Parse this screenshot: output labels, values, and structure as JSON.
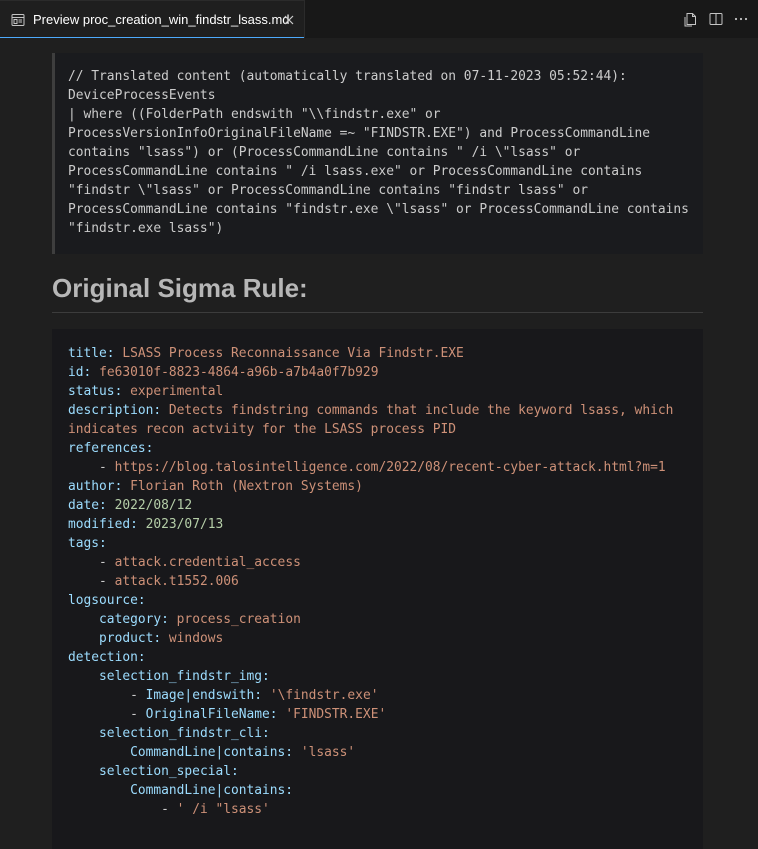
{
  "tab": {
    "label": "Preview proc_creation_win_findstr_lsass.md",
    "icon": "preview-icon",
    "close_icon": "close-icon"
  },
  "actions": [
    {
      "name": "open-source-icon"
    },
    {
      "name": "split-editor-icon"
    },
    {
      "name": "more-actions-icon"
    }
  ],
  "translated": {
    "lines": [
      "// Translated content (automatically translated on 07-11-2023 05:52:44):",
      "DeviceProcessEvents",
      "| where ((FolderPath endswith \"\\\\findstr.exe\" or",
      "ProcessVersionInfoOriginalFileName =~ \"FINDSTR.EXE\") and ProcessCommandLine",
      "contains \"lsass\") or (ProcessCommandLine contains \" /i \\\"lsass\" or",
      "ProcessCommandLine contains \" /i lsass.exe\" or ProcessCommandLine contains",
      "\"findstr \\\"lsass\" or ProcessCommandLine contains \"findstr lsass\" or",
      "ProcessCommandLine contains \"findstr.exe \\\"lsass\" or ProcessCommandLine contains",
      "\"findstr.exe lsass\")"
    ]
  },
  "heading": "Original Sigma Rule:",
  "rule": {
    "title_key": "title:",
    "title_val": "LSASS Process Reconnaissance Via Findstr.EXE",
    "id_key": "id:",
    "id_val": "fe63010f-8823-4864-a96b-a7b4a0f7b929",
    "status_key": "status:",
    "status_val": "experimental",
    "description_key": "description:",
    "description_val1": "Detects findstring commands that include the keyword lsass, which",
    "description_val2": "indicates recon actviity for the LSASS process PID",
    "references_key": "references:",
    "references_item": "https://blog.talosintelligence.com/2022/08/recent-cyber-attack.html?m=1",
    "author_key": "author:",
    "author_val": "Florian Roth (Nextron Systems)",
    "date_key": "date:",
    "date_val": "2022/08/12",
    "modified_key": "modified:",
    "modified_val": "2023/07/13",
    "tags_key": "tags:",
    "tag1": "attack.credential_access",
    "tag2": "attack.t1552.006",
    "logsource_key": "logsource:",
    "category_key": "category:",
    "category_val": "process_creation",
    "product_key": "product:",
    "product_val": "windows",
    "detection_key": "detection:",
    "sel_img_key": "selection_findstr_img:",
    "img_item1_key": "Image|endswith:",
    "img_item1_val": "'\\findstr.exe'",
    "img_item2_key": "OriginalFileName:",
    "img_item2_val": "'FINDSTR.EXE'",
    "sel_cli_key": "selection_findstr_cli:",
    "cli_key": "CommandLine|contains:",
    "cli_val": "'lsass'",
    "sel_special_key": "selection_special:",
    "special_key": "CommandLine|contains:",
    "special_item1": "' /i \"lsass'"
  }
}
